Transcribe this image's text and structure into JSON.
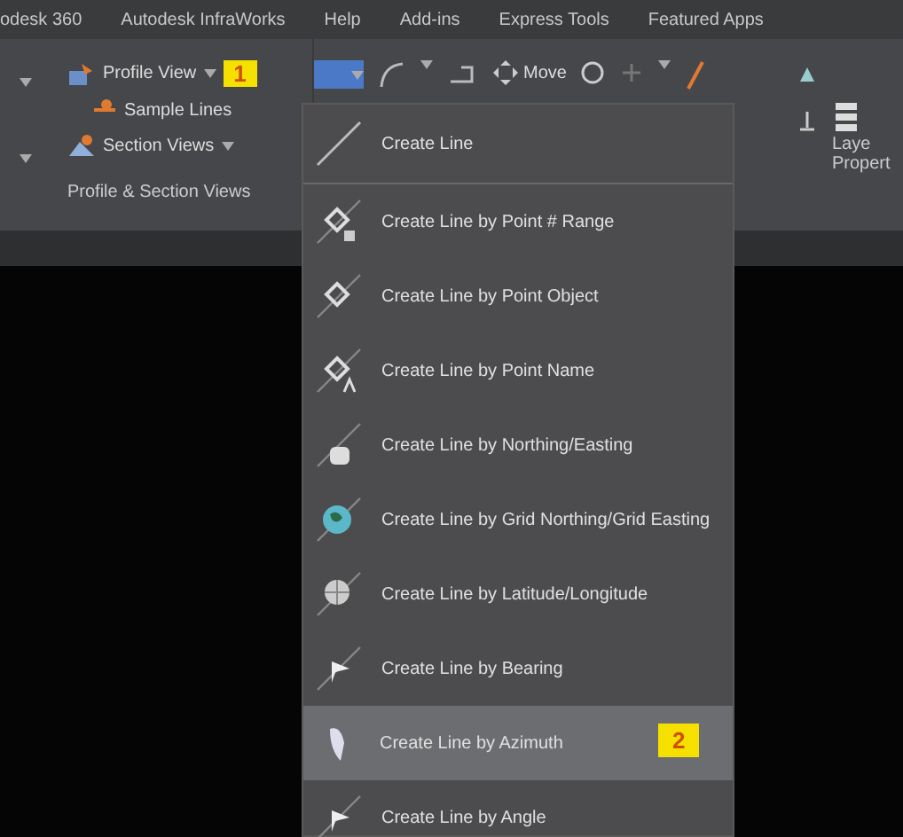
{
  "menu_bar": {
    "tabs": [
      "odesk 360",
      "Autodesk InfraWorks",
      "Help",
      "Add-ins",
      "Express Tools",
      "Featured Apps"
    ]
  },
  "ribbon": {
    "profile_view": {
      "label": "Profile View",
      "badge": "1"
    },
    "sample_lines": {
      "label": "Sample Lines"
    },
    "section_views": {
      "label": "Section Views"
    },
    "panel_title": "Profile & Section Views",
    "move": {
      "label": "Move"
    },
    "layer_properties": [
      "Laye",
      "Propert"
    ]
  },
  "dropdown": {
    "items": [
      {
        "label": "Create Line",
        "kind": "line",
        "selected": false
      },
      {
        "label": "Create Line by Point # Range",
        "kind": "point-range",
        "selected": false
      },
      {
        "label": "Create Line by Point Object",
        "kind": "point-object",
        "selected": false
      },
      {
        "label": "Create Line by Point Name",
        "kind": "point-name",
        "selected": false
      },
      {
        "label": "Create Line by Northing/Easting",
        "kind": "northing",
        "selected": false
      },
      {
        "label": "Create Line by Grid Northing/Grid Easting",
        "kind": "grid",
        "selected": false
      },
      {
        "label": "Create Line by Latitude/Longitude",
        "kind": "latlong",
        "selected": false
      },
      {
        "label": "Create Line by Bearing",
        "kind": "bearing",
        "selected": false
      },
      {
        "label": "Create Line by Azimuth",
        "kind": "azimuth",
        "selected": true,
        "badge": "2"
      },
      {
        "label": "Create Line by Angle",
        "kind": "angle",
        "selected": false
      }
    ]
  }
}
